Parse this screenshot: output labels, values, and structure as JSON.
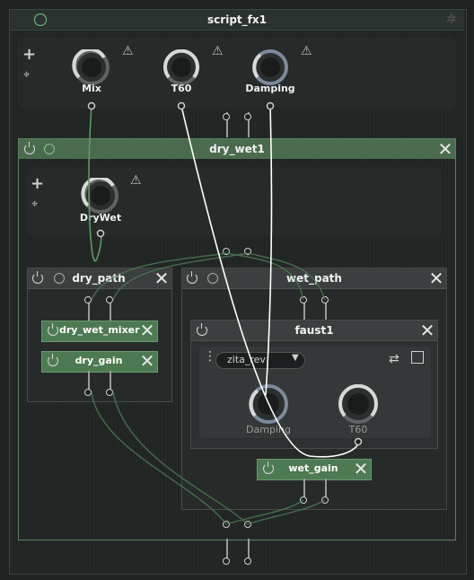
{
  "root": {
    "title": "script_fx1"
  },
  "root_params": [
    {
      "label": "Mix",
      "level": 0.6
    },
    {
      "label": "T60",
      "level": 0.75
    },
    {
      "label": "Damping",
      "level": 0.35
    }
  ],
  "dry_wet_chain": {
    "title": "dry_wet1",
    "param": {
      "label": "DryWet",
      "level": 0.5
    }
  },
  "dry_path": {
    "title": "dry_path",
    "modules": [
      "dry_wet_mixer",
      "dry_gain"
    ]
  },
  "wet_path": {
    "title": "wet_path",
    "module": "wet_gain"
  },
  "faust": {
    "title": "faust1",
    "selected": "zita_rev",
    "params": [
      {
        "label": "Damping",
        "level": 0.35
      },
      {
        "label": "T60",
        "level": 0.75
      }
    ]
  },
  "colors": {
    "chain_green": "#4b6b4e",
    "module_green": "#4d7a52",
    "wire_white": "#ffffff",
    "wire_green": "#5e9a62"
  }
}
